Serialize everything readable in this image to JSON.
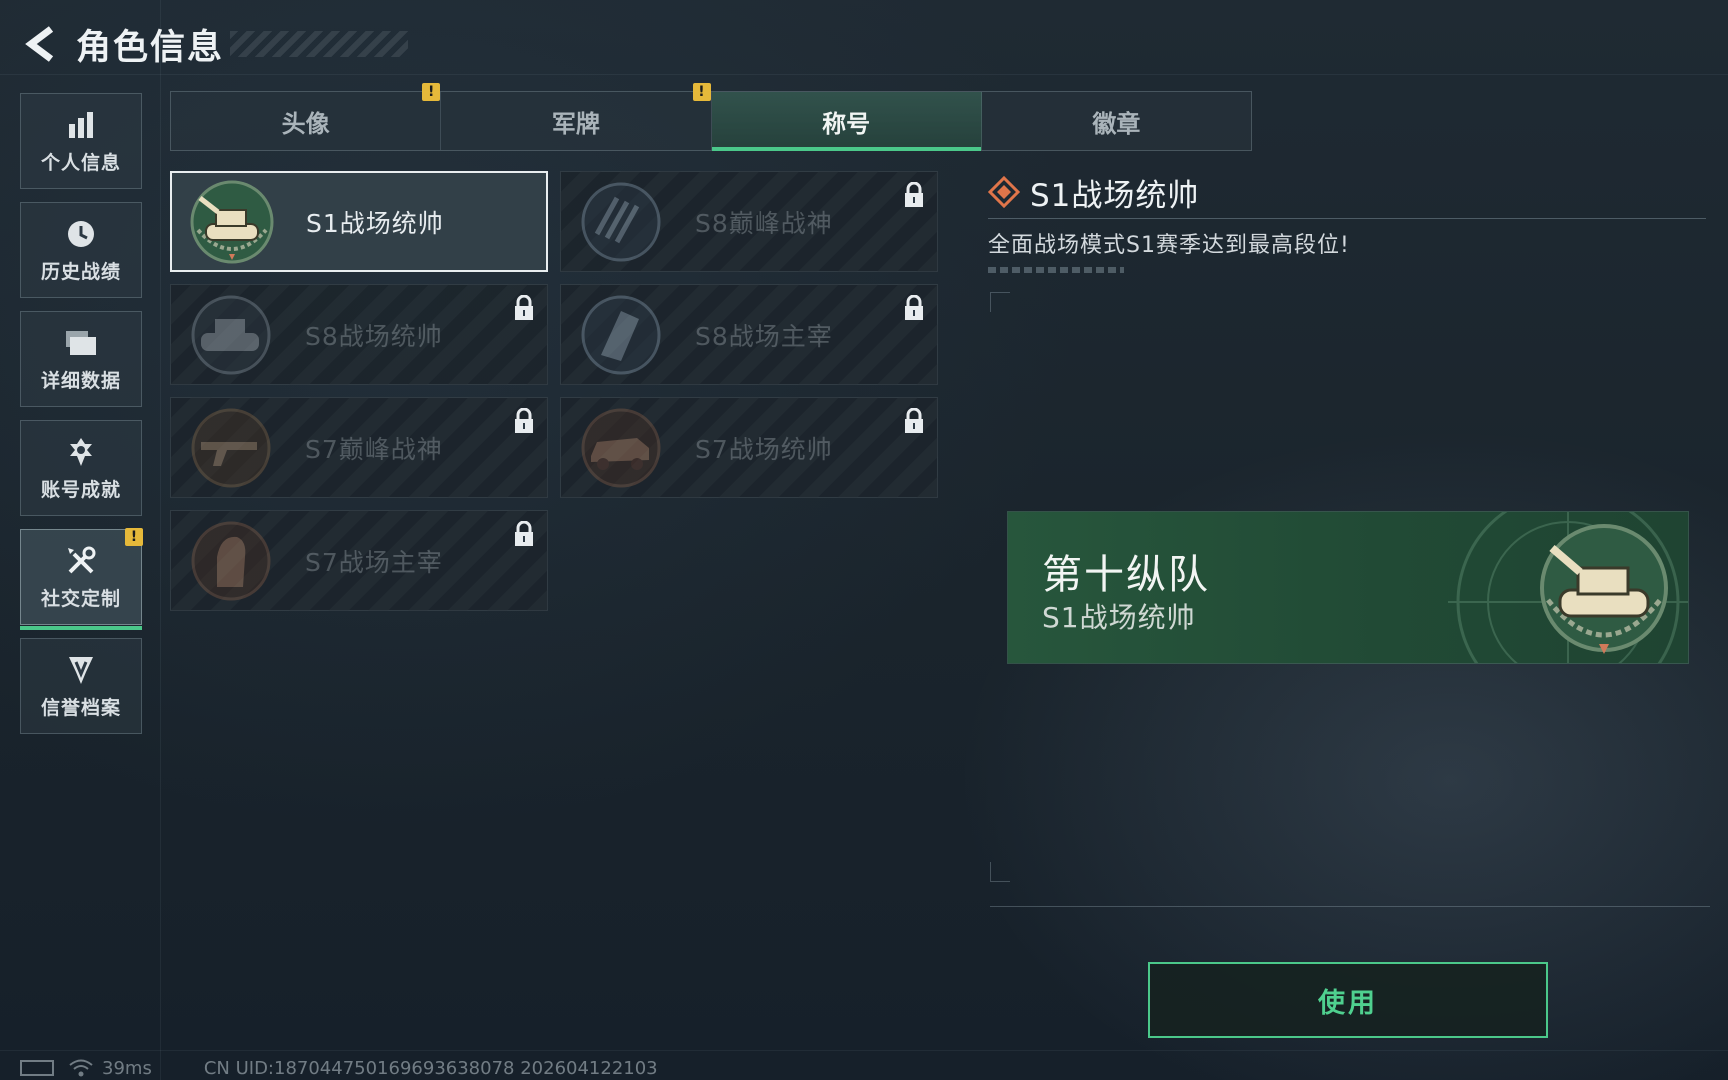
{
  "header": {
    "title": "角色信息"
  },
  "sidebar": {
    "items": [
      {
        "label": "个人信息",
        "icon": "bar-chart-icon"
      },
      {
        "label": "历史战绩",
        "icon": "history-clock-icon"
      },
      {
        "label": "详细数据",
        "icon": "folder-icon"
      },
      {
        "label": "账号成就",
        "icon": "achievement-icon"
      },
      {
        "label": "社交定制",
        "icon": "tools-icon",
        "active": true,
        "alert": "!"
      },
      {
        "label": "信誉档案",
        "icon": "credit-shield-icon"
      }
    ]
  },
  "tabs": [
    {
      "label": "头像",
      "alert": "!"
    },
    {
      "label": "军牌",
      "alert": "!"
    },
    {
      "label": "称号",
      "active": true
    },
    {
      "label": "徽章"
    }
  ],
  "cards": [
    {
      "label": "S1战场统帅",
      "selected": true,
      "locked": false,
      "emblem": "tank-emblem"
    },
    {
      "label": "S8巅峰战神",
      "locked": true,
      "emblem": "slash-emblem"
    },
    {
      "label": "S8战场统帅",
      "locked": true,
      "emblem": "tank-emblem"
    },
    {
      "label": "S8战场主宰",
      "locked": true,
      "emblem": "building-emblem"
    },
    {
      "label": "S7巅峰战神",
      "locked": true,
      "emblem": "rifle-emblem"
    },
    {
      "label": "S7战场统帅",
      "locked": true,
      "emblem": "vehicle-emblem"
    },
    {
      "label": "S7战场主宰",
      "locked": true,
      "emblem": "soldier-emblem"
    }
  ],
  "detail": {
    "title": "S1战场统帅",
    "description": "全面战场模式S1赛季达到最高段位!"
  },
  "preview": {
    "name": "第十纵队",
    "title": "S1战场统帅"
  },
  "actions": {
    "use_label": "使用"
  },
  "status": {
    "ping": "39ms",
    "uid": "CN UID:187044750169693638078 202604122103"
  },
  "colors": {
    "accent": "#4bc88a",
    "alert": "#e6b93a",
    "banner": "#27563c"
  }
}
